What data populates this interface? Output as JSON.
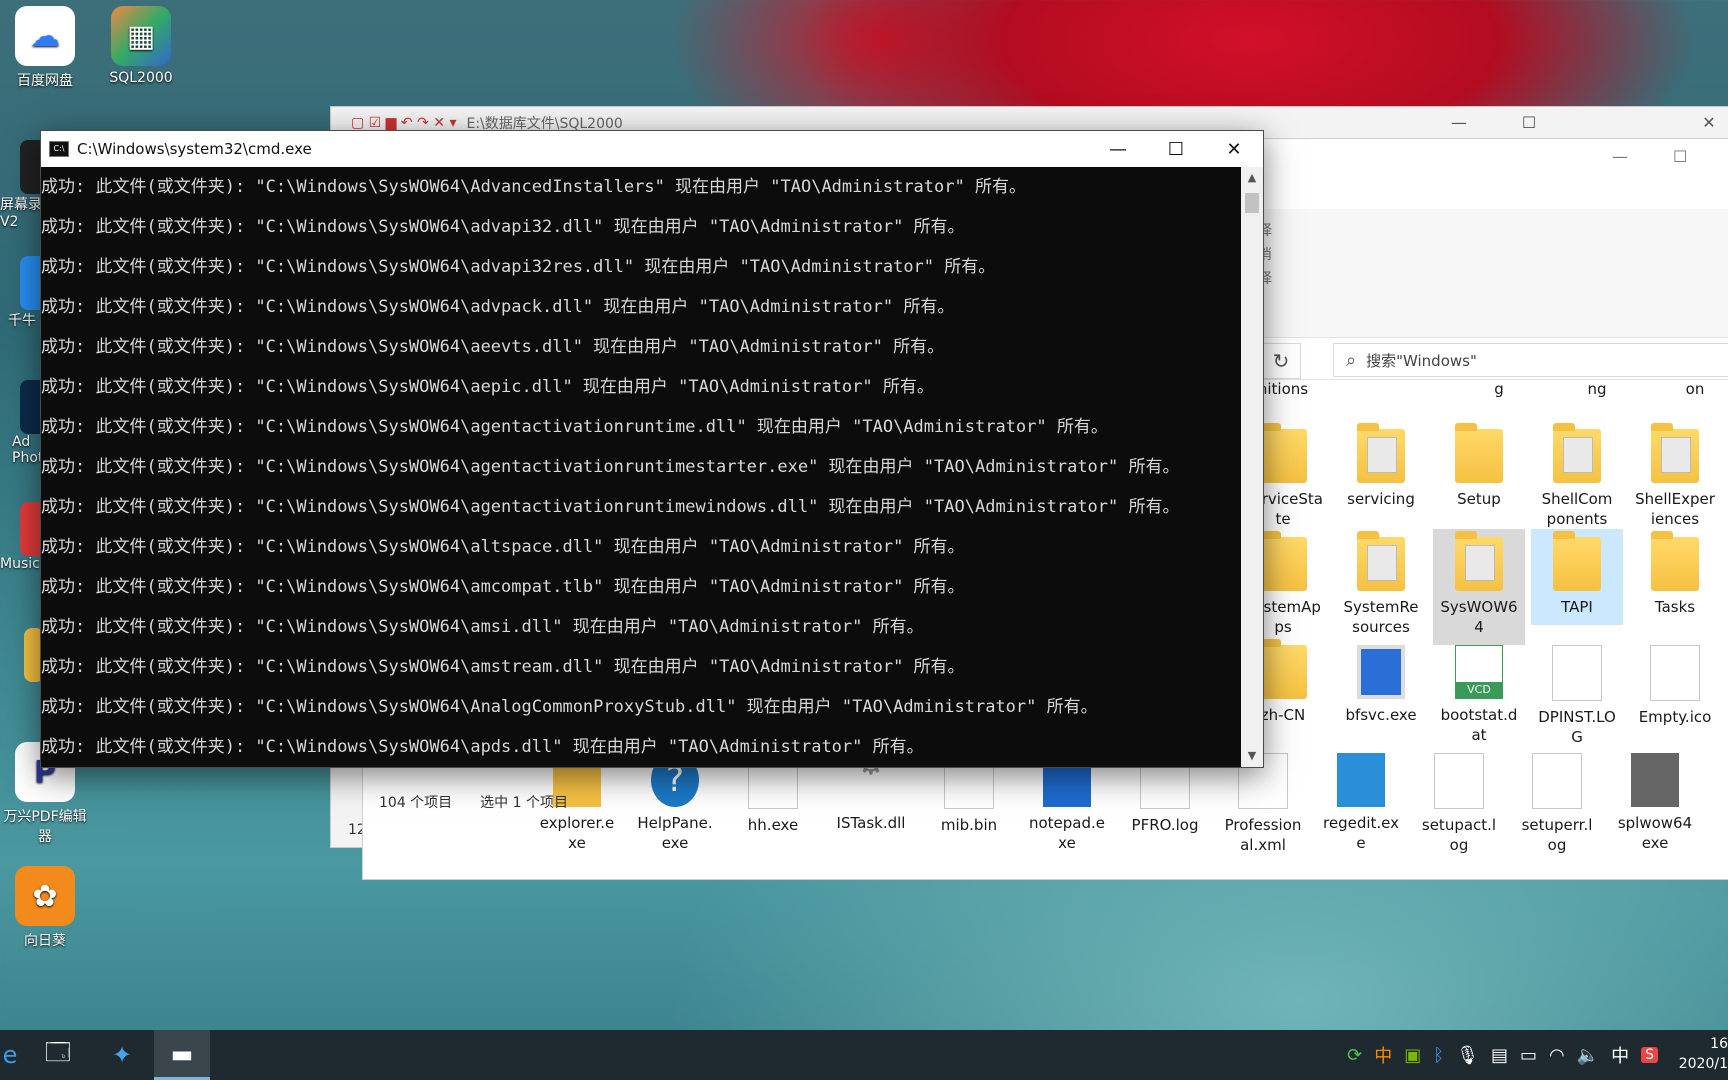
{
  "desktop": {
    "icons": [
      {
        "label": "百度网盘",
        "glyph": "☁"
      },
      {
        "label": "SQL2000",
        "glyph": "▦"
      },
      {
        "label": "万兴PDF编辑器",
        "glyph": "P"
      },
      {
        "label": "向日葵",
        "glyph": "✿"
      }
    ],
    "partial_labels": [
      "屏幕录\nV2",
      "千牛",
      "Ad\nPhot",
      "Music"
    ]
  },
  "explorer_back": {
    "title": "E:\\数据库文件\\SQL2000",
    "partial_left": "12"
  },
  "explorer": {
    "ribbon_marks": [
      "择",
      "消",
      "择"
    ],
    "search_placeholder": "搜索\"Windows\"",
    "top_row_labels": [
      "nitions",
      "g",
      "ng",
      "on"
    ],
    "rows": [
      [
        {
          "name": "ServiceSta\nte",
          "kind": "folder"
        },
        {
          "name": "servicing",
          "kind": "folder-docs"
        },
        {
          "name": "Setup",
          "kind": "folder"
        },
        {
          "name": "ShellCom\nponents",
          "kind": "folder-docs"
        },
        {
          "name": "ShellExper\niences",
          "kind": "folder-docs"
        }
      ],
      [
        {
          "name": "SystemAp\nps",
          "kind": "folder"
        },
        {
          "name": "SystemRe\nsources",
          "kind": "folder-docs"
        },
        {
          "name": "SysWOW6\n4",
          "kind": "folder-docs",
          "state": "hover"
        },
        {
          "name": "TAPI",
          "kind": "folder",
          "state": "selected"
        },
        {
          "name": "Tasks",
          "kind": "folder"
        }
      ],
      [
        {
          "name": "zh-CN",
          "kind": "folder"
        },
        {
          "name": "bfsvc.exe",
          "kind": "exe"
        },
        {
          "name": "bootstat.d\nat",
          "kind": "vcd"
        },
        {
          "name": "DPINST.LO\nG",
          "kind": "doc"
        },
        {
          "name": "Empty.ico",
          "kind": "doc"
        }
      ]
    ],
    "bottom_row": [
      {
        "name": "explorer.e\nxe"
      },
      {
        "name": "HelpPane.\nexe"
      },
      {
        "name": "hh.exe"
      },
      {
        "name": "ISTask.dll"
      },
      {
        "name": "mib.bin"
      },
      {
        "name": "notepad.e\nxe"
      },
      {
        "name": "PFRO.log"
      },
      {
        "name": "Profession\nal.xml"
      },
      {
        "name": "regedit.ex\ne"
      },
      {
        "name": "setupact.l\nog"
      },
      {
        "name": "setuperr.l\nog"
      },
      {
        "name": "splwow64\nexe"
      }
    ],
    "status": {
      "count": "104 个项目",
      "selected": "选中 1 个项目"
    }
  },
  "cmd": {
    "title": "C:\\Windows\\system32\\cmd.exe",
    "lines": [
      "成功: 此文件(或文件夹): \"C:\\Windows\\SysWOW64\\AdvancedInstallers\" 现在由用户 \"TAO\\Administrator\" 所有。",
      "成功: 此文件(或文件夹): \"C:\\Windows\\SysWOW64\\advapi32.dll\" 现在由用户 \"TAO\\Administrator\" 所有。",
      "成功: 此文件(或文件夹): \"C:\\Windows\\SysWOW64\\advapi32res.dll\" 现在由用户 \"TAO\\Administrator\" 所有。",
      "成功: 此文件(或文件夹): \"C:\\Windows\\SysWOW64\\advpack.dll\" 现在由用户 \"TAO\\Administrator\" 所有。",
      "成功: 此文件(或文件夹): \"C:\\Windows\\SysWOW64\\aeevts.dll\" 现在由用户 \"TAO\\Administrator\" 所有。",
      "成功: 此文件(或文件夹): \"C:\\Windows\\SysWOW64\\aepic.dll\" 现在由用户 \"TAO\\Administrator\" 所有。",
      "成功: 此文件(或文件夹): \"C:\\Windows\\SysWOW64\\agentactivationruntime.dll\" 现在由用户 \"TAO\\Administrator\" 所有。",
      "成功: 此文件(或文件夹): \"C:\\Windows\\SysWOW64\\agentactivationruntimestarter.exe\" 现在由用户 \"TAO\\Administrator\" 所有。",
      "成功: 此文件(或文件夹): \"C:\\Windows\\SysWOW64\\agentactivationruntimewindows.dll\" 现在由用户 \"TAO\\Administrator\" 所有。",
      "成功: 此文件(或文件夹): \"C:\\Windows\\SysWOW64\\altspace.dll\" 现在由用户 \"TAO\\Administrator\" 所有。",
      "成功: 此文件(或文件夹): \"C:\\Windows\\SysWOW64\\amcompat.tlb\" 现在由用户 \"TAO\\Administrator\" 所有。",
      "成功: 此文件(或文件夹): \"C:\\Windows\\SysWOW64\\amsi.dll\" 现在由用户 \"TAO\\Administrator\" 所有。",
      "成功: 此文件(或文件夹): \"C:\\Windows\\SysWOW64\\amstream.dll\" 现在由用户 \"TAO\\Administrator\" 所有。",
      "成功: 此文件(或文件夹): \"C:\\Windows\\SysWOW64\\AnalogCommonProxyStub.dll\" 现在由用户 \"TAO\\Administrator\" 所有。",
      "成功: 此文件(或文件夹): \"C:\\Windows\\SysWOW64\\apds.dll\" 现在由用户 \"TAO\\Administrator\" 所有。"
    ]
  },
  "taskbar": {
    "tray": [
      "中",
      "S"
    ],
    "clock_time": "16",
    "clock_date": "2020/1"
  }
}
